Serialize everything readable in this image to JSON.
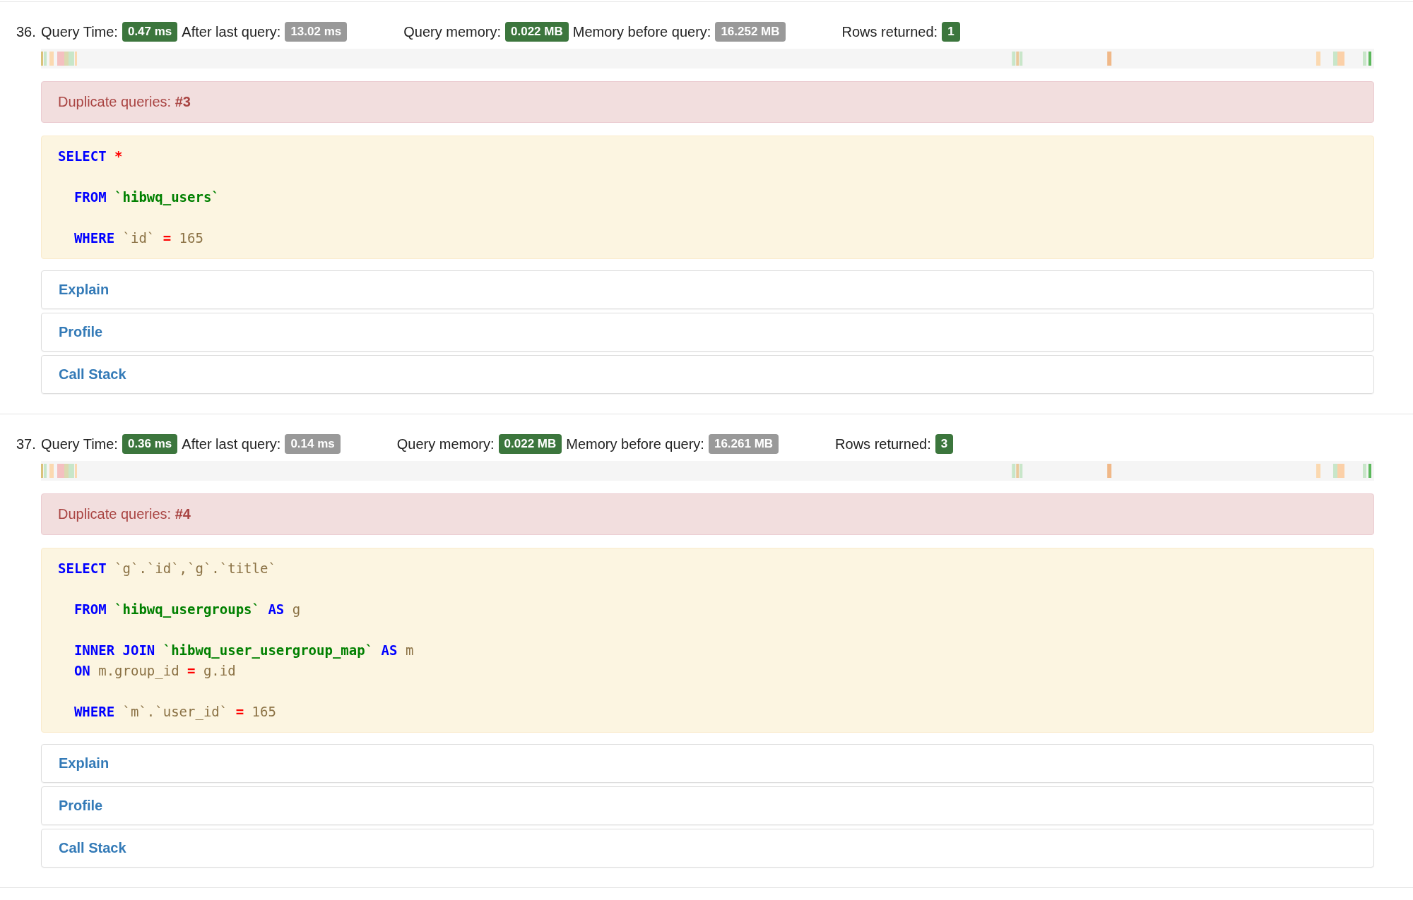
{
  "queries": [
    {
      "number": "36.",
      "stat_groups": [
        [
          {
            "label": "Query Time:",
            "value": "0.47 ms",
            "color": "#3c763d"
          },
          {
            "label": "After last query:",
            "value": "13.02 ms",
            "color": "#999999"
          }
        ],
        [
          {
            "label": "Query memory:",
            "value": "0.022 MB",
            "color": "#3c763d"
          },
          {
            "label": "Memory before query:",
            "value": "16.252 MB",
            "color": "#999999"
          }
        ],
        [
          {
            "label": "Rows returned:",
            "value": "1",
            "color": "#3c763d"
          }
        ]
      ],
      "duplicate": {
        "label": "Duplicate queries:",
        "ref": "#3"
      },
      "code": [
        {
          "indented": false,
          "gap_before": false,
          "tokens": [
            {
              "kind": "keyword",
              "text": "SELECT"
            },
            {
              "kind": "operator",
              "text": "*"
            }
          ]
        },
        {
          "indented": true,
          "gap_before": true,
          "tokens": [
            {
              "kind": "keyword",
              "text": "FROM"
            },
            {
              "kind": "table",
              "text": "`hibwq_users`"
            }
          ]
        },
        {
          "indented": true,
          "gap_before": true,
          "tokens": [
            {
              "kind": "keyword",
              "text": "WHERE"
            },
            {
              "kind": "plain",
              "text": "`id`"
            },
            {
              "kind": "operator",
              "text": "="
            },
            {
              "kind": "plain",
              "text": "165"
            }
          ]
        }
      ],
      "actions": [
        "Explain",
        "Profile",
        "Call Stack"
      ]
    },
    {
      "number": "37.",
      "stat_groups": [
        [
          {
            "label": "Query Time:",
            "value": "0.36 ms",
            "color": "#3c763d"
          },
          {
            "label": "After last query:",
            "value": "0.14 ms",
            "color": "#999999"
          }
        ],
        [
          {
            "label": "Query memory:",
            "value": "0.022 MB",
            "color": "#3c763d"
          },
          {
            "label": "Memory before query:",
            "value": "16.261 MB",
            "color": "#999999"
          }
        ],
        [
          {
            "label": "Rows returned:",
            "value": "3",
            "color": "#3c763d"
          }
        ]
      ],
      "duplicate": {
        "label": "Duplicate queries:",
        "ref": "#4"
      },
      "code": [
        {
          "indented": false,
          "gap_before": false,
          "tokens": [
            {
              "kind": "keyword",
              "text": "SELECT"
            },
            {
              "kind": "plain",
              "text": "`g`.`id`,`g`.`title`"
            }
          ]
        },
        {
          "indented": true,
          "gap_before": true,
          "tokens": [
            {
              "kind": "keyword",
              "text": "FROM"
            },
            {
              "kind": "table",
              "text": "`hibwq_usergroups`"
            },
            {
              "kind": "keyword",
              "text": "AS"
            },
            {
              "kind": "plain",
              "text": "g"
            }
          ]
        },
        {
          "indented": true,
          "gap_before": true,
          "tokens": [
            {
              "kind": "keyword",
              "text": "INNER JOIN"
            },
            {
              "kind": "table",
              "text": "`hibwq_user_usergroup_map`"
            },
            {
              "kind": "keyword",
              "text": "AS"
            },
            {
              "kind": "plain",
              "text": "m"
            }
          ]
        },
        {
          "indented": true,
          "gap_before": false,
          "tokens": [
            {
              "kind": "keyword",
              "text": "ON"
            },
            {
              "kind": "plain",
              "text": "m.group_id"
            },
            {
              "kind": "operator",
              "text": "="
            },
            {
              "kind": "plain",
              "text": "g.id"
            }
          ]
        },
        {
          "indented": true,
          "gap_before": true,
          "tokens": [
            {
              "kind": "keyword",
              "text": "WHERE"
            },
            {
              "kind": "plain",
              "text": "`m`.`user_id`"
            },
            {
              "kind": "operator",
              "text": "="
            },
            {
              "kind": "plain",
              "text": "165"
            }
          ]
        }
      ],
      "actions": [
        "Explain",
        "Profile",
        "Call Stack"
      ]
    }
  ]
}
